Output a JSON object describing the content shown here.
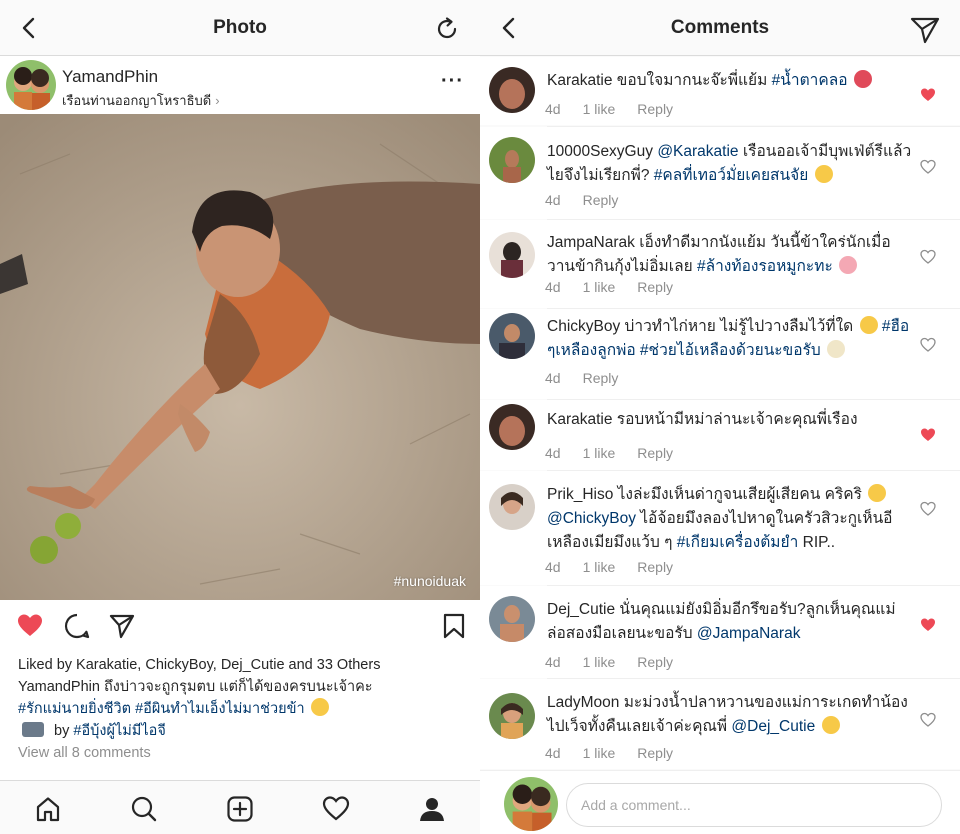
{
  "left": {
    "topbar": {
      "title": "Photo"
    },
    "post": {
      "username": "YamandPhin",
      "location": "เรือนท่านออกญาโหราธิบดี",
      "location_chevron": "›",
      "more": "···",
      "photo_tag": "#nunoiduak"
    },
    "likes": {
      "prefix": "Liked by",
      "names": "Karakatie, ChickyBoy, Dej_Cutie",
      "suffix": "and 33 Others"
    },
    "caption": {
      "user": "YamandPhin",
      "text": "ถึงบ่าวจะถูกรุมตบ แต่ก็ได้ของครบนะเจ้าคะ",
      "tags": "#รักแม่นายยิ่งชีวิต #อีผินทำไมเอ็งไม่มาช่วยข้า",
      "by_label": "by",
      "by_tag": "#อีบุ้งผู้ไม่มีไอจี",
      "view_all": "View all 8 comments"
    },
    "colors": {
      "heart": "#ed4956",
      "tag": "#00376b",
      "muted": "#8e8e8e"
    }
  },
  "right": {
    "topbar": {
      "title": "Comments"
    },
    "comments": [
      {
        "user": "Karakatie",
        "text": "ขอบใจมากนะจ๊ะพี่แย้ม",
        "tag": "#น้ำตาคลอ",
        "after": "",
        "age": "4d",
        "likes": "1 like",
        "reply": "Reply",
        "liked": true
      },
      {
        "user": "10000SexyGuy",
        "mention": "@Karakatie",
        "text": "เรือนออเจ้ามีบุพเฟ่ต์รีแล้วไยจึงไม่เรียกพี่?",
        "tag": "#คลที่เทอว์มั่ยเคยสนจัย",
        "age": "4d",
        "reply": "Reply",
        "liked": false
      },
      {
        "user": "JampaNarak",
        "text": "เอ็งทำดีมากนังแย้ม วันนี้ข้าใคร่นักเมื่อวานข้ากินกุ้งไม่อิ่มเลย",
        "tag": "#ล้างท้องรอหมูกะทะ",
        "age": "4d",
        "likes": "1 like",
        "reply": "Reply",
        "liked": false
      },
      {
        "user": "ChickyBoy",
        "text": "บ่าวทำไก่หาย ไม่รู้ไปวางลืมไว้ที่ใด",
        "tag": "#ฮือ ๆเหลืองลูกพ่อ #ช่วยไอ้เหลืองด้วยนะขอรับ",
        "age": "4d",
        "reply": "Reply",
        "liked": false
      },
      {
        "user": "Karakatie",
        "text": "รอบหน้ามีหม่าล่านะเจ้าคะคุณพี่เรือง",
        "age": "4d",
        "likes": "1 like",
        "reply": "Reply",
        "liked": true
      },
      {
        "user": "Prik_Hiso",
        "text": "ไงล่ะมึงเห็นด่ากูจนเสียผู้เสียคน คริคริ",
        "mention": "@ChickyBoy",
        "text2": "ไอ้จ้อยมึงลองไปหาดูในครัวสิวะกูเห็นอีเหลืองเมียมึงแว้บ ๆ",
        "tag": "#เกียมเครื่องต้มยำ",
        "after": "RIP..",
        "age": "4d",
        "likes": "1 like",
        "reply": "Reply",
        "liked": false
      },
      {
        "user": "Dej_Cutie",
        "text": "นั่นคุณแม่ยังมิอิ่มอีกรึขอรับ?ลูกเห็นคุณแม่ล่อสองมือเลยนะขอรับ",
        "mention": "@JampaNarak",
        "age": "4d",
        "likes": "1 like",
        "reply": "Reply",
        "liked": true
      },
      {
        "user": "LadyMoon",
        "text": "มะม่วงน้ำปลาหวานของแม่การะเกดทำน้องไปเว็จทั้งคืนเลยเจ้าค่ะคุณพี่",
        "mention": "@Dej_Cutie",
        "age": "4d",
        "likes": "1 like",
        "reply": "Reply",
        "liked": false
      }
    ],
    "add_comment_placeholder": "Add a comment..."
  }
}
